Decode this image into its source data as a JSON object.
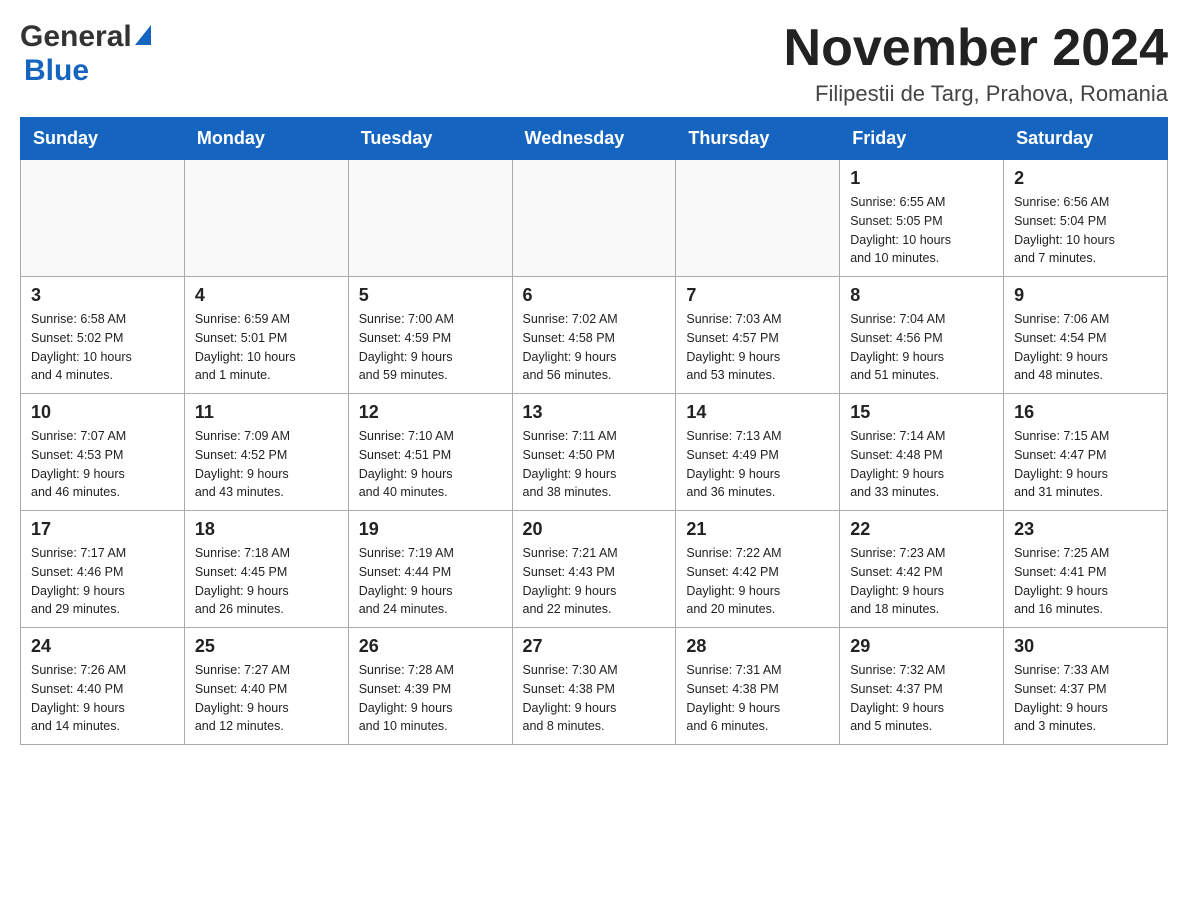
{
  "header": {
    "logo_general": "General",
    "logo_blue": "Blue",
    "title": "November 2024",
    "subtitle": "Filipestii de Targ, Prahova, Romania"
  },
  "calendar": {
    "days_of_week": [
      "Sunday",
      "Monday",
      "Tuesday",
      "Wednesday",
      "Thursday",
      "Friday",
      "Saturday"
    ],
    "weeks": [
      [
        {
          "day": "",
          "info": ""
        },
        {
          "day": "",
          "info": ""
        },
        {
          "day": "",
          "info": ""
        },
        {
          "day": "",
          "info": ""
        },
        {
          "day": "",
          "info": ""
        },
        {
          "day": "1",
          "info": "Sunrise: 6:55 AM\nSunset: 5:05 PM\nDaylight: 10 hours\nand 10 minutes."
        },
        {
          "day": "2",
          "info": "Sunrise: 6:56 AM\nSunset: 5:04 PM\nDaylight: 10 hours\nand 7 minutes."
        }
      ],
      [
        {
          "day": "3",
          "info": "Sunrise: 6:58 AM\nSunset: 5:02 PM\nDaylight: 10 hours\nand 4 minutes."
        },
        {
          "day": "4",
          "info": "Sunrise: 6:59 AM\nSunset: 5:01 PM\nDaylight: 10 hours\nand 1 minute."
        },
        {
          "day": "5",
          "info": "Sunrise: 7:00 AM\nSunset: 4:59 PM\nDaylight: 9 hours\nand 59 minutes."
        },
        {
          "day": "6",
          "info": "Sunrise: 7:02 AM\nSunset: 4:58 PM\nDaylight: 9 hours\nand 56 minutes."
        },
        {
          "day": "7",
          "info": "Sunrise: 7:03 AM\nSunset: 4:57 PM\nDaylight: 9 hours\nand 53 minutes."
        },
        {
          "day": "8",
          "info": "Sunrise: 7:04 AM\nSunset: 4:56 PM\nDaylight: 9 hours\nand 51 minutes."
        },
        {
          "day": "9",
          "info": "Sunrise: 7:06 AM\nSunset: 4:54 PM\nDaylight: 9 hours\nand 48 minutes."
        }
      ],
      [
        {
          "day": "10",
          "info": "Sunrise: 7:07 AM\nSunset: 4:53 PM\nDaylight: 9 hours\nand 46 minutes."
        },
        {
          "day": "11",
          "info": "Sunrise: 7:09 AM\nSunset: 4:52 PM\nDaylight: 9 hours\nand 43 minutes."
        },
        {
          "day": "12",
          "info": "Sunrise: 7:10 AM\nSunset: 4:51 PM\nDaylight: 9 hours\nand 40 minutes."
        },
        {
          "day": "13",
          "info": "Sunrise: 7:11 AM\nSunset: 4:50 PM\nDaylight: 9 hours\nand 38 minutes."
        },
        {
          "day": "14",
          "info": "Sunrise: 7:13 AM\nSunset: 4:49 PM\nDaylight: 9 hours\nand 36 minutes."
        },
        {
          "day": "15",
          "info": "Sunrise: 7:14 AM\nSunset: 4:48 PM\nDaylight: 9 hours\nand 33 minutes."
        },
        {
          "day": "16",
          "info": "Sunrise: 7:15 AM\nSunset: 4:47 PM\nDaylight: 9 hours\nand 31 minutes."
        }
      ],
      [
        {
          "day": "17",
          "info": "Sunrise: 7:17 AM\nSunset: 4:46 PM\nDaylight: 9 hours\nand 29 minutes."
        },
        {
          "day": "18",
          "info": "Sunrise: 7:18 AM\nSunset: 4:45 PM\nDaylight: 9 hours\nand 26 minutes."
        },
        {
          "day": "19",
          "info": "Sunrise: 7:19 AM\nSunset: 4:44 PM\nDaylight: 9 hours\nand 24 minutes."
        },
        {
          "day": "20",
          "info": "Sunrise: 7:21 AM\nSunset: 4:43 PM\nDaylight: 9 hours\nand 22 minutes."
        },
        {
          "day": "21",
          "info": "Sunrise: 7:22 AM\nSunset: 4:42 PM\nDaylight: 9 hours\nand 20 minutes."
        },
        {
          "day": "22",
          "info": "Sunrise: 7:23 AM\nSunset: 4:42 PM\nDaylight: 9 hours\nand 18 minutes."
        },
        {
          "day": "23",
          "info": "Sunrise: 7:25 AM\nSunset: 4:41 PM\nDaylight: 9 hours\nand 16 minutes."
        }
      ],
      [
        {
          "day": "24",
          "info": "Sunrise: 7:26 AM\nSunset: 4:40 PM\nDaylight: 9 hours\nand 14 minutes."
        },
        {
          "day": "25",
          "info": "Sunrise: 7:27 AM\nSunset: 4:40 PM\nDaylight: 9 hours\nand 12 minutes."
        },
        {
          "day": "26",
          "info": "Sunrise: 7:28 AM\nSunset: 4:39 PM\nDaylight: 9 hours\nand 10 minutes."
        },
        {
          "day": "27",
          "info": "Sunrise: 7:30 AM\nSunset: 4:38 PM\nDaylight: 9 hours\nand 8 minutes."
        },
        {
          "day": "28",
          "info": "Sunrise: 7:31 AM\nSunset: 4:38 PM\nDaylight: 9 hours\nand 6 minutes."
        },
        {
          "day": "29",
          "info": "Sunrise: 7:32 AM\nSunset: 4:37 PM\nDaylight: 9 hours\nand 5 minutes."
        },
        {
          "day": "30",
          "info": "Sunrise: 7:33 AM\nSunset: 4:37 PM\nDaylight: 9 hours\nand 3 minutes."
        }
      ]
    ]
  }
}
